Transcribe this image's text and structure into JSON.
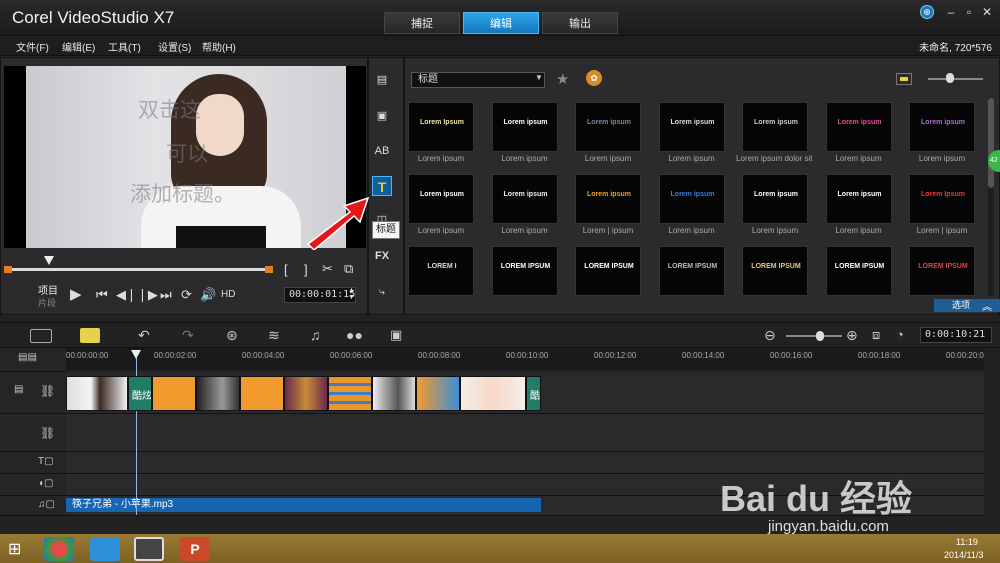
{
  "app": {
    "title": "Corel VideoStudio X7",
    "project": "未命名, 720*576"
  },
  "tabs": [
    {
      "label": "捕捉"
    },
    {
      "label": "编辑"
    },
    {
      "label": "输出"
    }
  ],
  "menu": [
    {
      "label": "文件(F)"
    },
    {
      "label": "编辑(E)"
    },
    {
      "label": "工具(T)"
    },
    {
      "label": "设置(S)"
    },
    {
      "label": "帮助(H)"
    }
  ],
  "preview": {
    "ghost_text": [
      "双击这",
      "可以",
      "添加标题。"
    ],
    "project_label": "项目",
    "clip_label": "片段",
    "timecode": "00:00:01:15",
    "hd_label": "HD"
  },
  "side_toolbar": {
    "tooltip": "标题",
    "fx_label": "FX"
  },
  "library": {
    "category": "标题",
    "options_label": "选项",
    "badge": "42",
    "thumbnails": [
      {
        "text": "Lorem Ipsum",
        "caption": "Lorem ipsum",
        "color": "#f2e6a0"
      },
      {
        "text": "Lorem ipsum",
        "caption": "Lorem ipsum",
        "color": "#ffffff"
      },
      {
        "text": "Lorem ipsum",
        "caption": "Lorem ipsum",
        "color": "#7a8aa0"
      },
      {
        "text": "Lorem ipsum",
        "caption": "Lorem ipsum",
        "color": "#dddddd"
      },
      {
        "text": "Lorem ipsum",
        "caption": "Lorem ipsum dolor sit ...",
        "color": "#cccccc"
      },
      {
        "text": "Lorem ipsum",
        "caption": "Lorem ipsum",
        "color": "#e24b9b"
      },
      {
        "text": "Lorem ipsum",
        "caption": "Lorem ipsum",
        "color": "#b46ad6"
      },
      {
        "text": "Lorem ipsum",
        "caption": "Lorem ipsum",
        "color": "#ffffff"
      },
      {
        "text": "Lorem ipsum",
        "caption": "Lorem ipsum",
        "color": "#eeeeee"
      },
      {
        "text": "Lorem ipsum",
        "caption": "Lorem | ipsum",
        "color": "#e9a02c"
      },
      {
        "text": "Lorem ipsum",
        "caption": "Lorem ipsum",
        "color": "#3a7bd5"
      },
      {
        "text": "Lorem ipsum",
        "caption": "Lorem ipsum",
        "color": "#ffffff"
      },
      {
        "text": "Lorem ipsum",
        "caption": "Lorem ipsum",
        "color": "#ffffff"
      },
      {
        "text": "Lorem Ipsum",
        "caption": "Lorem | ipsum",
        "color": "#e63b3b"
      },
      {
        "text": "LOREM I",
        "caption": "",
        "color": "#dddddd"
      },
      {
        "text": "LOREM IPSUM",
        "caption": "",
        "color": "#ffffff"
      },
      {
        "text": "LOREM IPSUM",
        "caption": "",
        "color": "#ffffff"
      },
      {
        "text": "LOREM IPSUM",
        "caption": "",
        "color": "#bbbbbb"
      },
      {
        "text": "LOREM IPSUM",
        "caption": "",
        "color": "#e6c48a"
      },
      {
        "text": "LOREM IPSUM",
        "caption": "",
        "color": "#ffffff"
      },
      {
        "text": "LOREM IPSUM",
        "caption": "",
        "color": "#e04040"
      }
    ]
  },
  "timeline": {
    "timecode": "0:00:10:21",
    "ruler": [
      "00:00:00:00",
      "00:00:02:00",
      "00:00:04:00",
      "00:00:06:00",
      "00:00:08:00",
      "00:00:10:00",
      "00:00:12:00",
      "00:00:14:00",
      "00:00:16:00",
      "00:00:18:00",
      "00:00:20:0"
    ],
    "transition_labels": [
      "酷炫",
      "酷"
    ],
    "audio_clip": "筷子兄弟 - 小苹果.mp3"
  },
  "taskbar": {
    "time": "11:19",
    "date": "2014/11/3"
  },
  "watermark": {
    "logo": "Bai du 经验",
    "url": "jingyan.baidu.com"
  }
}
